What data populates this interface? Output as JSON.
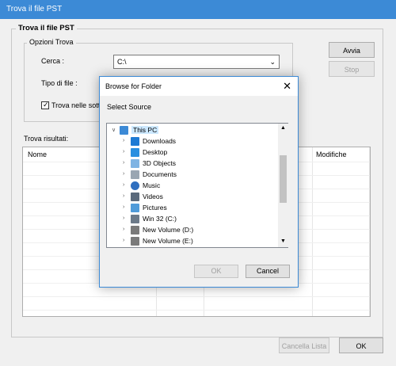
{
  "window": {
    "title": "Trova il file PST"
  },
  "main_group": {
    "title": "Trova il file PST"
  },
  "options": {
    "title": "Opzioni Trova",
    "search_label": "Cerca :",
    "search_value": "C:\\",
    "type_label": "Tipo di file :",
    "subfolders_label": "Trova nelle sotto",
    "subfolders_checked": true
  },
  "buttons": {
    "start": "Avvia",
    "stop": "Stop",
    "clear": "Cancella Lista",
    "ok": "OK"
  },
  "results": {
    "title": "Trova risultati:",
    "col_name": "Nome",
    "col_modified": "Modifiche"
  },
  "dialog": {
    "title": "Browse for Folder",
    "subtitle": "Select Source",
    "ok": "OK",
    "cancel": "Cancel",
    "tree": [
      {
        "label": "This PC",
        "icon": "computer-icon",
        "expanded": true,
        "selected": true
      },
      {
        "label": "Downloads",
        "icon": "downloads-icon"
      },
      {
        "label": "Desktop",
        "icon": "desktop-icon"
      },
      {
        "label": "3D Objects",
        "icon": "cube-icon"
      },
      {
        "label": "Documents",
        "icon": "documents-icon"
      },
      {
        "label": "Music",
        "icon": "music-icon"
      },
      {
        "label": "Videos",
        "icon": "videos-icon"
      },
      {
        "label": "Pictures",
        "icon": "pictures-icon"
      },
      {
        "label": "Win 32 (C:)",
        "icon": "windows-drive-icon"
      },
      {
        "label": "New Volume (D:)",
        "icon": "drive-icon"
      },
      {
        "label": "New Volume (E:)",
        "icon": "drive-icon"
      }
    ]
  },
  "colors": {
    "accent": "#3c8ad6",
    "selection": "#cce8ff"
  }
}
